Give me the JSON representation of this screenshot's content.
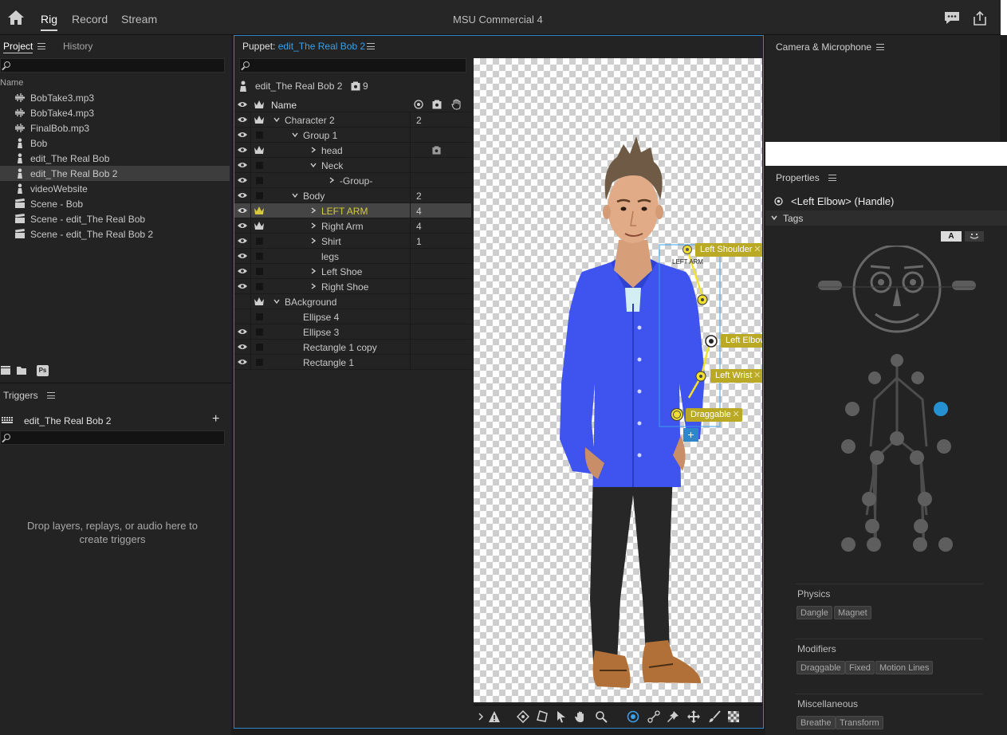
{
  "top_bar": {
    "modes": [
      "Rig",
      "Record",
      "Stream"
    ],
    "active_mode": "Rig",
    "title": "MSU Commercial 4"
  },
  "project_panel": {
    "tab_project": "Project",
    "tab_history": "History",
    "search_placeholder": "",
    "column_name": "Name",
    "items": [
      {
        "name": "BobTake3.mp3",
        "icon": "audio-icon"
      },
      {
        "name": "BobTake4.mp3",
        "icon": "audio-icon"
      },
      {
        "name": "FinalBob.mp3",
        "icon": "audio-icon"
      },
      {
        "name": "Bob",
        "icon": "puppet-icon"
      },
      {
        "name": "edit_The Real Bob",
        "icon": "puppet-icon"
      },
      {
        "name": "edit_The Real Bob 2",
        "icon": "puppet-icon",
        "selected": true
      },
      {
        "name": "videoWebsite",
        "icon": "puppet-icon"
      },
      {
        "name": "Scene - Bob",
        "icon": "scene-icon"
      },
      {
        "name": "Scene - edit_The Real Bob",
        "icon": "scene-icon"
      },
      {
        "name": "Scene - edit_The Real Bob 2",
        "icon": "scene-icon"
      }
    ],
    "footer_ps": "Ps"
  },
  "triggers_panel": {
    "title": "Triggers",
    "target": "edit_The Real Bob 2",
    "add_label": "+",
    "empty_message_line1": "Drop layers, replays, or audio here to",
    "empty_message_line2": "create triggers"
  },
  "puppet_panel": {
    "title_prefix": "Puppet:",
    "puppet_name": "edit_The Real Bob 2",
    "crumb": "edit_The Real Bob 2",
    "crumb_count": "9",
    "column_name": "Name",
    "layers": [
      {
        "name": "Character 2",
        "indent": 0,
        "chevron": "down",
        "eye": true,
        "crown": true,
        "count": "2"
      },
      {
        "name": "Group 1",
        "indent": 1,
        "chevron": "down",
        "eye": true,
        "crown": false,
        "count": ""
      },
      {
        "name": "head",
        "indent": 2,
        "chevron": "right",
        "eye": true,
        "crown": true,
        "count": "",
        "camera": true
      },
      {
        "name": "Neck",
        "indent": 2,
        "chevron": "down",
        "eye": true,
        "crown": false,
        "count": ""
      },
      {
        "name": "-Group-",
        "indent": 3,
        "chevron": "right",
        "eye": true,
        "crown": false,
        "count": ""
      },
      {
        "name": "Body",
        "indent": 1,
        "chevron": "down",
        "eye": true,
        "crown": false,
        "count": "2"
      },
      {
        "name": "LEFT ARM",
        "indent": 2,
        "chevron": "right",
        "eye": true,
        "crown": true,
        "count": "4",
        "selected": true
      },
      {
        "name": "Right Arm",
        "indent": 2,
        "chevron": "right",
        "eye": true,
        "crown": true,
        "count": "4"
      },
      {
        "name": "Shirt",
        "indent": 2,
        "chevron": "right",
        "eye": true,
        "crown": false,
        "count": "1"
      },
      {
        "name": "legs",
        "indent": 2,
        "chevron": "",
        "eye": true,
        "crown": false,
        "count": ""
      },
      {
        "name": "Left Shoe",
        "indent": 2,
        "chevron": "right",
        "eye": true,
        "crown": false,
        "count": ""
      },
      {
        "name": "Right Shoe",
        "indent": 2,
        "chevron": "right",
        "eye": true,
        "crown": false,
        "count": ""
      },
      {
        "name": "BAckground",
        "indent": 0,
        "chevron": "down",
        "eye": false,
        "crown": true,
        "count": ""
      },
      {
        "name": "Ellipse 4",
        "indent": 1,
        "chevron": "",
        "eye": false,
        "crown": false,
        "count": ""
      },
      {
        "name": "Ellipse 3",
        "indent": 1,
        "chevron": "",
        "eye": true,
        "crown": false,
        "count": ""
      },
      {
        "name": "Rectangle 1 copy",
        "indent": 1,
        "chevron": "",
        "eye": true,
        "crown": false,
        "count": ""
      },
      {
        "name": "Rectangle 1",
        "indent": 1,
        "chevron": "",
        "eye": true,
        "crown": false,
        "count": ""
      }
    ],
    "canvas": {
      "group_label": "LEFT ARM",
      "handles": [
        "Left Shoulder",
        "Left Elbow",
        "Left Wrist",
        "Draggable"
      ],
      "add_label": "+"
    }
  },
  "camera_panel": {
    "title": "Camera & Microphone"
  },
  "properties_panel": {
    "title": "Properties",
    "handle_name": "<Left Elbow> (Handle)",
    "tags_label": "Tags",
    "toggle_a": "A",
    "physics_label": "Physics",
    "physics_tags": [
      "Dangle",
      "Magnet"
    ],
    "modifiers_label": "Modifiers",
    "modifiers_tags": [
      "Draggable",
      "Fixed",
      "Motion Lines"
    ],
    "misc_label": "Miscellaneous",
    "misc_tags": [
      "Breathe",
      "Transform"
    ]
  },
  "colors": {
    "accent_blue": "#3aa0e8",
    "handle_yellow": "#b9a924",
    "selected_yellow": "#d6c940",
    "panel_bg": "#232323"
  }
}
